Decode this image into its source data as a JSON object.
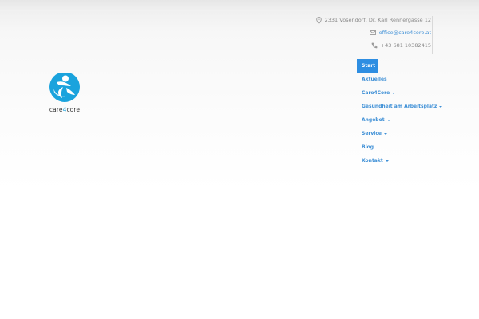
{
  "header": {
    "contact": {
      "address": "2331 Vösendorf, Dr. Karl Rennergasse 12",
      "email": "office@care4core.at",
      "phone": "+43 681 10382415"
    }
  },
  "logo": {
    "text_pre": "care",
    "text_num": "4",
    "text_post": "core"
  },
  "nav": {
    "items": [
      {
        "label": "Start",
        "dropdown": false,
        "active": true
      },
      {
        "label": "Aktuelles",
        "dropdown": false
      },
      {
        "label": "Care4Core",
        "dropdown": true
      },
      {
        "label": "Gesundheit am Arbeitsplatz",
        "dropdown": true
      },
      {
        "label": "Angebot",
        "dropdown": true
      },
      {
        "label": "Service",
        "dropdown": true
      },
      {
        "label": "Blog",
        "dropdown": false
      },
      {
        "label": "Kontakt",
        "dropdown": true
      }
    ]
  },
  "colors": {
    "accent": "#2e8ee2",
    "link": "#3d8fd6",
    "logo_blue": "#1aa3dd"
  },
  "icons": [
    "map-pin-icon",
    "mail-icon",
    "phone-icon",
    "chevron-down-icon"
  ]
}
